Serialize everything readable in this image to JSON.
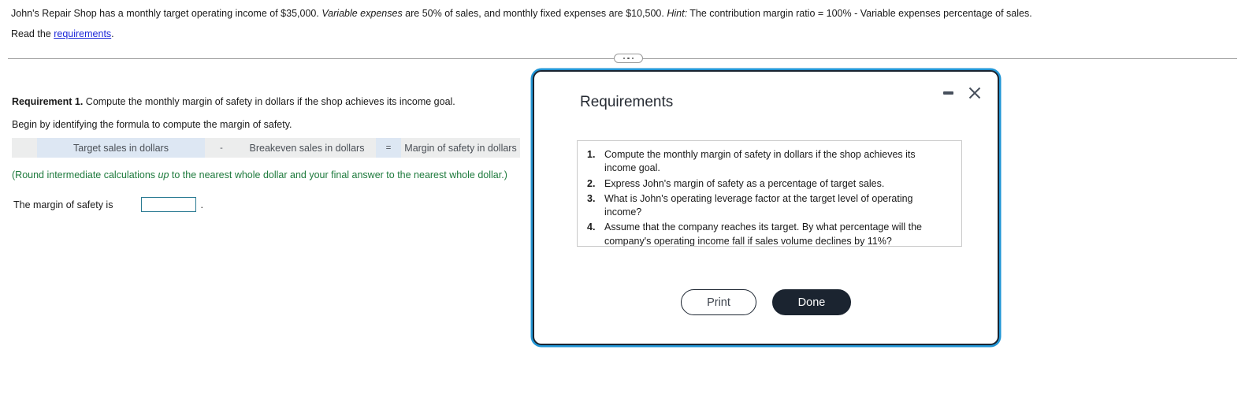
{
  "problem": {
    "line1_part1": "John's Repair Shop has a monthly target operating income of $35,000. ",
    "line1_em1": "Variable expenses",
    "line1_part2": " are 50% of sales, and monthly fixed expenses are $10,500. ",
    "line1_em2": "Hint:",
    "line1_part3": " The contribution margin ratio = 100% - Variable expenses percentage of sales.",
    "read_prefix": "Read the ",
    "read_link": "requirements",
    "read_suffix": "."
  },
  "worksheet": {
    "requirement_label": "Requirement 1.",
    "requirement_text": " Compute the monthly margin of safety in dollars if the shop achieves its income goal.",
    "begin_text": "Begin by identifying the formula to compute the margin of safety.",
    "formula": {
      "lead": "",
      "term1": "Target sales in dollars",
      "operator1": "-",
      "term2": "Breakeven sales in dollars",
      "operator2": "=",
      "term3": "Margin of safety in dollars"
    },
    "round_note_part1": "(Round intermediate calculations ",
    "round_note_em": "up",
    "round_note_part2": " to the nearest whole dollar and your final answer to the nearest whole dollar.)",
    "answer_label": "The margin of safety is",
    "answer_value": "",
    "answer_placeholder": "",
    "answer_period": "."
  },
  "dialog": {
    "title": "Requirements",
    "minimize_icon": "minimize-icon",
    "close_icon": "close-icon",
    "items": [
      {
        "num": "1.",
        "text": "Compute the monthly margin of safety in dollars if the shop achieves its income goal."
      },
      {
        "num": "2.",
        "text": "Express John's margin of safety as a percentage of target sales."
      },
      {
        "num": "3.",
        "text": "What is John's operating leverage factor at the target level of operating income?"
      },
      {
        "num": "4.",
        "text": "Assume that the company reaches its target. By what percentage will the company's operating income fall if sales volume declines by 11%?"
      }
    ],
    "print_label": "Print",
    "done_label": "Done"
  },
  "colors": {
    "link": "#1a26d8",
    "note_green": "#1d7a3c",
    "dialog_glow": "#2196d6",
    "dialog_border": "#1b2430",
    "input_border": "#2b7b93",
    "formula_blue": "#dde7f3",
    "formula_gray": "#eceded"
  },
  "handle_icon": "ellipsis-handle-icon"
}
